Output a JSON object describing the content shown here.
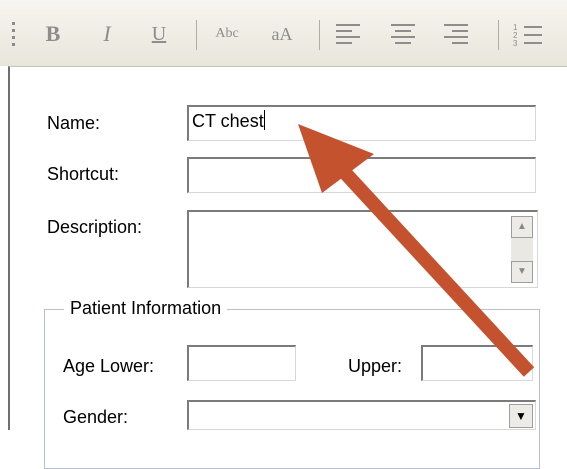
{
  "toolbar": {
    "bold_label": "B",
    "italic_label": "I",
    "underline_label": "U",
    "strikethrough_label": "Abc",
    "change_case_label": "aA"
  },
  "form": {
    "name_label": "Name:",
    "name_value": "CT chest",
    "shortcut_label": "Shortcut:",
    "shortcut_value": "",
    "description_label": "Description:",
    "description_value": "",
    "patient_info": {
      "legend": "Patient Information",
      "age_lower_label": "Age Lower:",
      "age_lower_value": "",
      "upper_label": "Upper:",
      "upper_value": "",
      "gender_label": "Gender:",
      "gender_value": ""
    }
  },
  "annotation": {
    "arrow_color": "#c4522f"
  }
}
